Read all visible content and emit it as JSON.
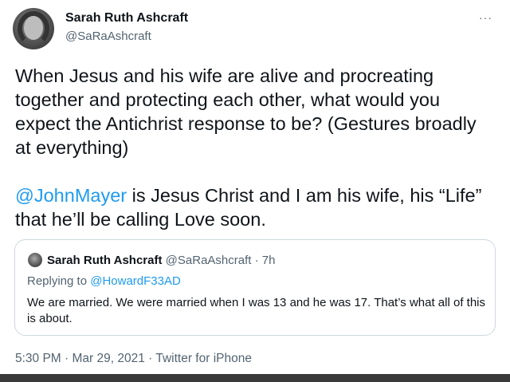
{
  "author": {
    "display_name": "Sarah Ruth Ashcraft",
    "handle": "@SaRaAshcraft"
  },
  "more_label": "···",
  "tweet": {
    "paragraph1": "When Jesus and his wife are alive and procreating together and protecting each other, what would you expect the Antichrist response to be? (Gestures broadly at everything)",
    "paragraph2_mention": "@JohnMayer",
    "paragraph2_text": " is Jesus Christ and I am his wife, his “Life” that he’ll be calling Love soon."
  },
  "quoted_tweet": {
    "display_name": "Sarah Ruth Ashcraft",
    "handle": "@SaRaAshcraft",
    "separator": " · ",
    "time_ago": "7h",
    "replying_prefix": "Replying to ",
    "replying_to": "@HowardF33AD",
    "text": "We are married. We were married when I was 13 and he was 17. That’s what all of this is about."
  },
  "footer": {
    "time": "5:30 PM",
    "separator1": " · ",
    "date": "Mar 29, 2021",
    "separator2": " · ",
    "source": "Twitter for iPhone"
  },
  "colors": {
    "link": "#1d9bf0",
    "secondary_text": "#536471",
    "border": "#cfd9de"
  }
}
